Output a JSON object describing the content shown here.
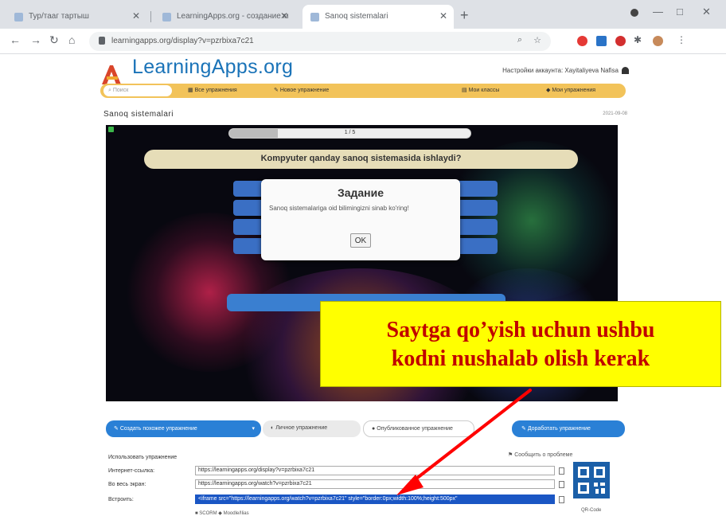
{
  "browser": {
    "tabs": [
      {
        "title": "Тур/тааг тартыш",
        "active": false
      },
      {
        "title": "LearningApps.org - создание м",
        "active": false
      },
      {
        "title": "Sanoq sistemalari",
        "active": true
      }
    ],
    "url": "learningapps.org/display?v=pzrbixa7c21",
    "new_tab_symbol": "+",
    "window_buttons": [
      "—",
      "□",
      "✕"
    ]
  },
  "site": {
    "logo": "LearningApps.org",
    "account": "Настройки аккаунта: Xayitaliyeva Nafisa",
    "search_placeholder": "Поиск",
    "nav_left": [
      "Все упражнения",
      "Новое упражнение"
    ],
    "nav_right": [
      "Мои классы",
      "Мои упражнения"
    ],
    "page_title": "Sanoq sistemalari",
    "date": "2021-09-08"
  },
  "game": {
    "progress_label": "1 / 5",
    "progress_fraction": 0.2,
    "question": "Kompyuter qanday sanoq sistemasida ishlaydi?",
    "dialog": {
      "title": "Задание",
      "body": "Sanoq sistemalariga oid bilimingizni sinab ko'ring!",
      "ok": "OK"
    }
  },
  "actions": {
    "similar": "Создать похожее упражнение",
    "private": "Личное упражнение",
    "published": "Опубликованное упражнение",
    "improve": "Доработать упражнение"
  },
  "embed": {
    "header": "Использовать упражнение",
    "share": "Сообщить о проблеме",
    "rows": [
      {
        "label": "Интернет-ссылка:",
        "value": "https://learningapps.org/display?v=pzrbixa7c21"
      },
      {
        "label": "Во весь экран:",
        "value": "https://learningapps.org/watch?v=pzrbixa7c21"
      },
      {
        "label": "Встроить:",
        "value": "<iframe src=\"https://learningapps.org/watch?v=pzrbixa7c21\" style=\"border:0px;width:100%;height:500px\""
      }
    ],
    "qr_label": "QR-Code",
    "bottom": "■ SCORM   ◆ Moodle/Ilias"
  },
  "callout": {
    "line1": "Saytga qo’yish uchun ushbu",
    "line2": "kodni nushalab olish kerak"
  },
  "colors": {
    "callout_bg": "#ffff00",
    "callout_text": "#c00000",
    "arrow": "#ff0000",
    "navbar": "#f2c35a",
    "accent_blue": "#2a80d6"
  }
}
